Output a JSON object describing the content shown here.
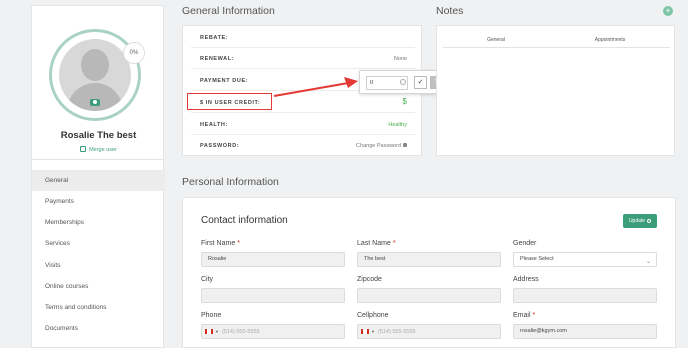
{
  "profile": {
    "completion": "0%",
    "name": "Rosalie The best",
    "merge_label": "Merge user"
  },
  "menu": [
    {
      "label": "General",
      "active": true
    },
    {
      "label": "Payments"
    },
    {
      "label": "Memberships"
    },
    {
      "label": "Services"
    },
    {
      "label": "Visits"
    },
    {
      "label": "Online courses"
    },
    {
      "label": "Terms and conditions"
    },
    {
      "label": "Documents"
    }
  ],
  "general": {
    "title": "General Information",
    "rows": [
      {
        "label": "REBATE:",
        "value": ""
      },
      {
        "label": "RENEWAL:",
        "value": "None"
      },
      {
        "label": "PAYMENT DUE:",
        "value": ""
      },
      {
        "label": "$ IN USER CREDIT:",
        "value": "$"
      },
      {
        "label": "HEALTH:",
        "value": "Healthy"
      },
      {
        "label": "PASSWORD:",
        "value": "Change Password"
      }
    ]
  },
  "popover": {
    "input_value": "0",
    "ok_icon": "check-icon",
    "cancel_icon": "close-icon"
  },
  "notes": {
    "title": "Notes",
    "add_icon": "plus-icon",
    "tabs": [
      "General",
      "Appointments"
    ]
  },
  "personal": {
    "title": "Personal Information",
    "contact_title": "Contact information",
    "update_label": "Update",
    "fields": {
      "first_name": {
        "label": "First Name",
        "value": "Rosalie"
      },
      "last_name": {
        "label": "Last Name",
        "value": "The best"
      },
      "gender": {
        "label": "Gender",
        "value": "Please Select"
      },
      "city": {
        "label": "City",
        "value": ""
      },
      "zipcode": {
        "label": "Zipcode",
        "value": ""
      },
      "address": {
        "label": "Address",
        "value": ""
      },
      "phone": {
        "label": "Phone",
        "placeholder": "(514) 555-5555"
      },
      "cellphone": {
        "label": "Cellphone",
        "placeholder": "(514) 555-5555"
      },
      "email": {
        "label": "Email",
        "value": "rosalie@kgym.com"
      }
    },
    "required_mark": "*"
  },
  "colors": {
    "accent": "#3c9d7b",
    "annotation_red": "#e53935",
    "healthy": "#4caf50"
  }
}
